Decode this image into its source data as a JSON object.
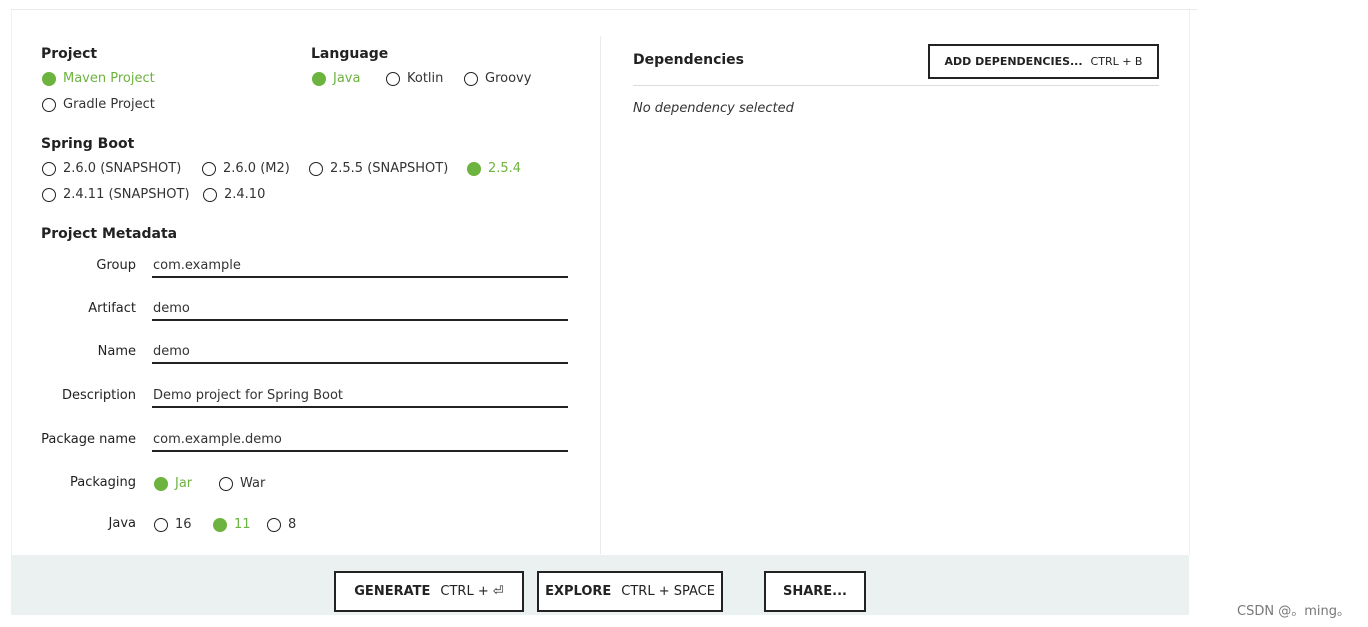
{
  "project": {
    "title": "Project",
    "options": [
      {
        "label": "Maven Project",
        "checked": true
      },
      {
        "label": "Gradle Project",
        "checked": false
      }
    ]
  },
  "language": {
    "title": "Language",
    "options": [
      {
        "label": "Java",
        "checked": true
      },
      {
        "label": "Kotlin",
        "checked": false
      },
      {
        "label": "Groovy",
        "checked": false
      }
    ]
  },
  "spring_boot": {
    "title": "Spring Boot",
    "options": [
      {
        "label": "2.6.0 (SNAPSHOT)",
        "checked": false
      },
      {
        "label": "2.6.0 (M2)",
        "checked": false
      },
      {
        "label": "2.5.5 (SNAPSHOT)",
        "checked": false
      },
      {
        "label": "2.5.4",
        "checked": true
      },
      {
        "label": "2.4.11 (SNAPSHOT)",
        "checked": false
      },
      {
        "label": "2.4.10",
        "checked": false
      }
    ]
  },
  "metadata": {
    "title": "Project Metadata",
    "fields": [
      {
        "label": "Group",
        "value": "com.example"
      },
      {
        "label": "Artifact",
        "value": "demo"
      },
      {
        "label": "Name",
        "value": "demo"
      },
      {
        "label": "Description",
        "value": "Demo project for Spring Boot"
      },
      {
        "label": "Package name",
        "value": "com.example.demo"
      }
    ],
    "packaging": {
      "label": "Packaging",
      "options": [
        {
          "label": "Jar",
          "checked": true
        },
        {
          "label": "War",
          "checked": false
        }
      ]
    },
    "java": {
      "label": "Java",
      "options": [
        {
          "label": "16",
          "checked": false
        },
        {
          "label": "11",
          "checked": true
        },
        {
          "label": "8",
          "checked": false
        }
      ]
    }
  },
  "dependencies": {
    "title": "Dependencies",
    "add_label": "ADD DEPENDENCIES...",
    "add_shortcut": "CTRL + B",
    "empty_text": "No dependency selected"
  },
  "footer": {
    "generate_label": "GENERATE",
    "generate_shortcut": "CTRL + ⏎",
    "explore_label": "EXPLORE",
    "explore_shortcut": "CTRL + SPACE",
    "share_label": "SHARE..."
  },
  "watermark": "CSDN @。ming。",
  "colors": {
    "accent": "#6db33f",
    "footer_bg": "#ebf0f0",
    "border": "#222222"
  }
}
